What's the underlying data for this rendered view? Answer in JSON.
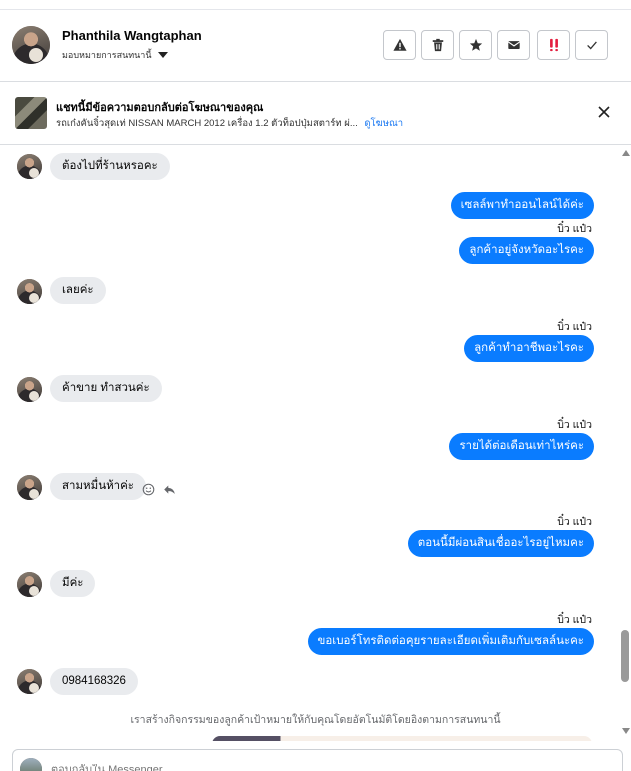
{
  "contact": {
    "name": "Phanthila Wangtaphan",
    "assign_label": "มอบหมายการสนทนานี้"
  },
  "toolbar": {
    "buttons": [
      {
        "name": "report-button",
        "icon": "warning-icon"
      },
      {
        "name": "delete-button",
        "icon": "trash-icon"
      },
      {
        "name": "star-button",
        "icon": "star-icon"
      },
      {
        "name": "mark-unread-button",
        "icon": "envelope-icon"
      },
      {
        "name": "important-button",
        "icon": "exclamation-icon"
      },
      {
        "name": "done-button",
        "icon": "check-icon"
      }
    ]
  },
  "ad_banner": {
    "title": "แชทนี้มีข้อความตอบกลับต่อโฆษณาของคุณ",
    "subtitle": "รถเก๋งคันจิ๋วสุดเท่ NISSAN MARCH 2012 เครื่อง 1.2 ตัวท็อปปุ่มสตาร์ท ผ่...",
    "link": "ดูโฆษณา"
  },
  "messages": [
    {
      "dir": "in",
      "text": "ต้องไปที่ร้านหรอคะ"
    },
    {
      "dir": "out",
      "text": "เซลล์พาทำออนไลน์ได้ค่ะ"
    },
    {
      "dir": "out",
      "sender": "บิ๋ว แป๋ว",
      "text": "ลูกค้าอยู่จังหวัดอะไรคะ"
    },
    {
      "dir": "in",
      "text": "เลยค่ะ"
    },
    {
      "dir": "out",
      "sender": "บิ๋ว แป๋ว",
      "text": "ลูกค้าทำอาชีพอะไรคะ"
    },
    {
      "dir": "in",
      "text": "ค้าขาย ทำสวนค่ะ"
    },
    {
      "dir": "out",
      "sender": "บิ๋ว แป๋ว",
      "text": "รายได้ต่อเดือนเท่าไหร่คะ"
    },
    {
      "dir": "in",
      "text": "สามหมื่นห้าค่ะ"
    },
    {
      "dir": "out",
      "sender": "บิ๋ว แป๋ว",
      "text": "ตอนนี้มีผ่อนสินเชื่ออะไรอยู่ไหมคะ"
    },
    {
      "dir": "in",
      "text": "มีค่ะ"
    },
    {
      "dir": "out",
      "sender": "บิ๋ว แป๋ว",
      "text": "ขอเบอร์โทรติดต่อคุยรายละเอียดเพิ่มเติมกับเซลล์นะคะ"
    },
    {
      "dir": "in",
      "text": "0984168326"
    }
  ],
  "system_note": "เราสร้างกิจกรรมของลูกค้าเป้าหมายให้กับคุณโดยอัตโนมัติโดยอิงตามการสนทนานี้",
  "composer": {
    "placeholder": "ตอบกลับใน Messenger..."
  }
}
